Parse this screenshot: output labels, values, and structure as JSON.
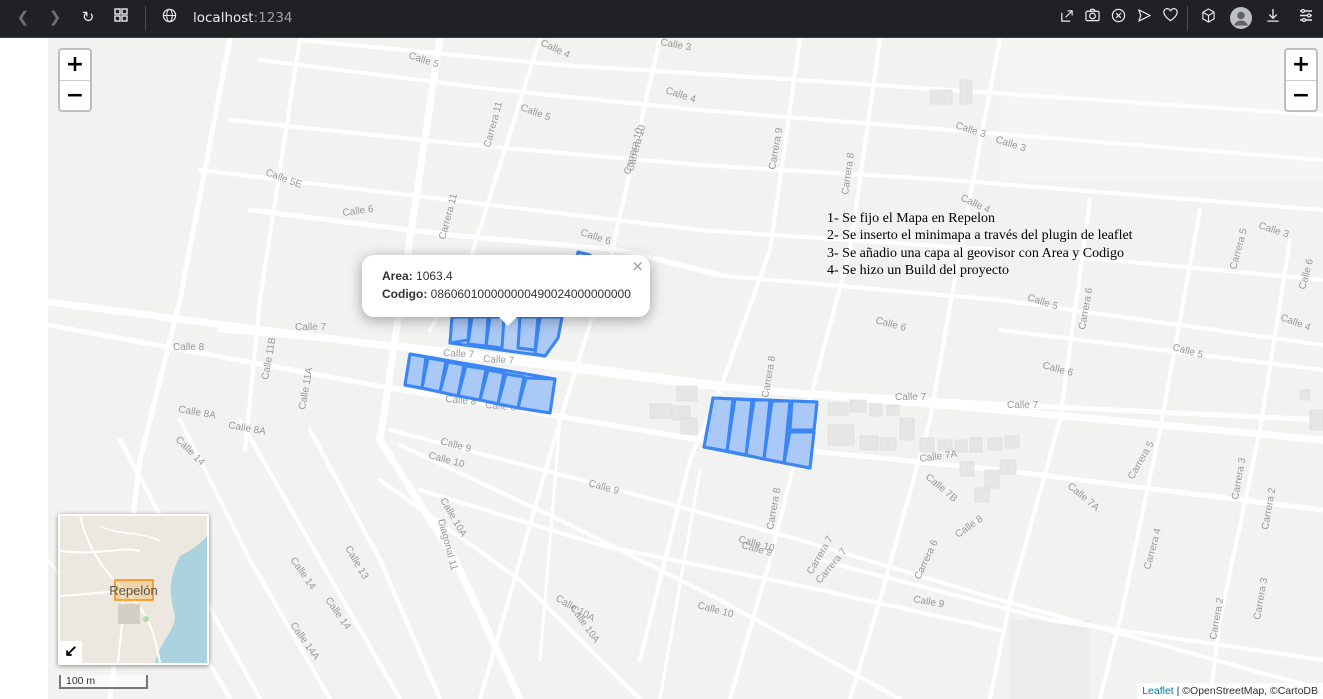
{
  "browser": {
    "url_host": "localhost",
    "url_port": ":1234",
    "icons": [
      "back-icon",
      "forward-icon",
      "reload-icon",
      "tabs-grid-icon",
      "site-info-icon",
      "share-icon",
      "camera-icon",
      "close-circle-icon",
      "send-icon",
      "heart-icon",
      "cube-icon",
      "profile-icon",
      "download-icon",
      "menu-icon"
    ]
  },
  "map": {
    "zoom_in": "+",
    "zoom_out": "−",
    "popup": {
      "area_label": "Area:",
      "area_value": "1063.4",
      "codigo_label": "Codigo:",
      "codigo_value": "086060100000000490024000000000",
      "close": "×"
    },
    "notes": [
      "1- Se fijo el Mapa en Repelon",
      "2- Se inserto el minimapa a través del plugin de leaflet",
      "3- Se añadio una capa al geovisor con Area y Codigo",
      "4- Se hizo un Build del proyecto"
    ],
    "minimap": {
      "label": "Repelón",
      "toggle": "↙"
    },
    "scale": "100 m",
    "attribution": {
      "leaflet": "Leaflet",
      "rest": " | ©OpenStreetMap, ©CartoDB"
    },
    "street_labels": [
      "Calle 5",
      "Calle 3",
      "Calle 4",
      "Calle 5",
      "Calle 4",
      "Carrera 11",
      "Carrera 10",
      "Carrera 9",
      "Carrera 8",
      "Calle 3",
      "Calle 3",
      "Calle 5E",
      "Calle 6",
      "Carrera 11",
      "Calle 6",
      "Calle 4",
      "Calle 3",
      "Calle 7",
      "Calle 8",
      "Calle 7",
      "Calle 7",
      "Calle 8",
      "Calle 8",
      "Calle 5",
      "Calle 6",
      "Calle 6",
      "Calle 4",
      "Calle 5",
      "Calle 6",
      "Calle 8A",
      "Calle 8A",
      "Calle 9",
      "Calle 10",
      "Calle 9",
      "Calle 7",
      "Calle 7",
      "Calle 7A",
      "Calle 7B",
      "Calle 7A",
      "Calle 14",
      "Diagonal 11",
      "Calle 10A",
      "Calle 13",
      "Calle 10",
      "Calle 9",
      "Calle 8",
      "Calle 10A",
      "Calle 10",
      "Calle 9",
      "Calle 14",
      "Calle 14",
      "Calle 14A",
      "Calle 10A",
      "Carrera 8",
      "Carrera 7",
      "Carrera 6",
      "Carrera 5",
      "Carrera 4",
      "Carrera 3",
      "Carrera 2",
      "Carrera 5",
      "Carrera 6",
      "Calle 11B",
      "Calle 11A",
      "Carrera 10",
      "Carrera 3",
      "Carrera 2",
      "Carrera 8",
      "Carrera 7"
    ]
  }
}
